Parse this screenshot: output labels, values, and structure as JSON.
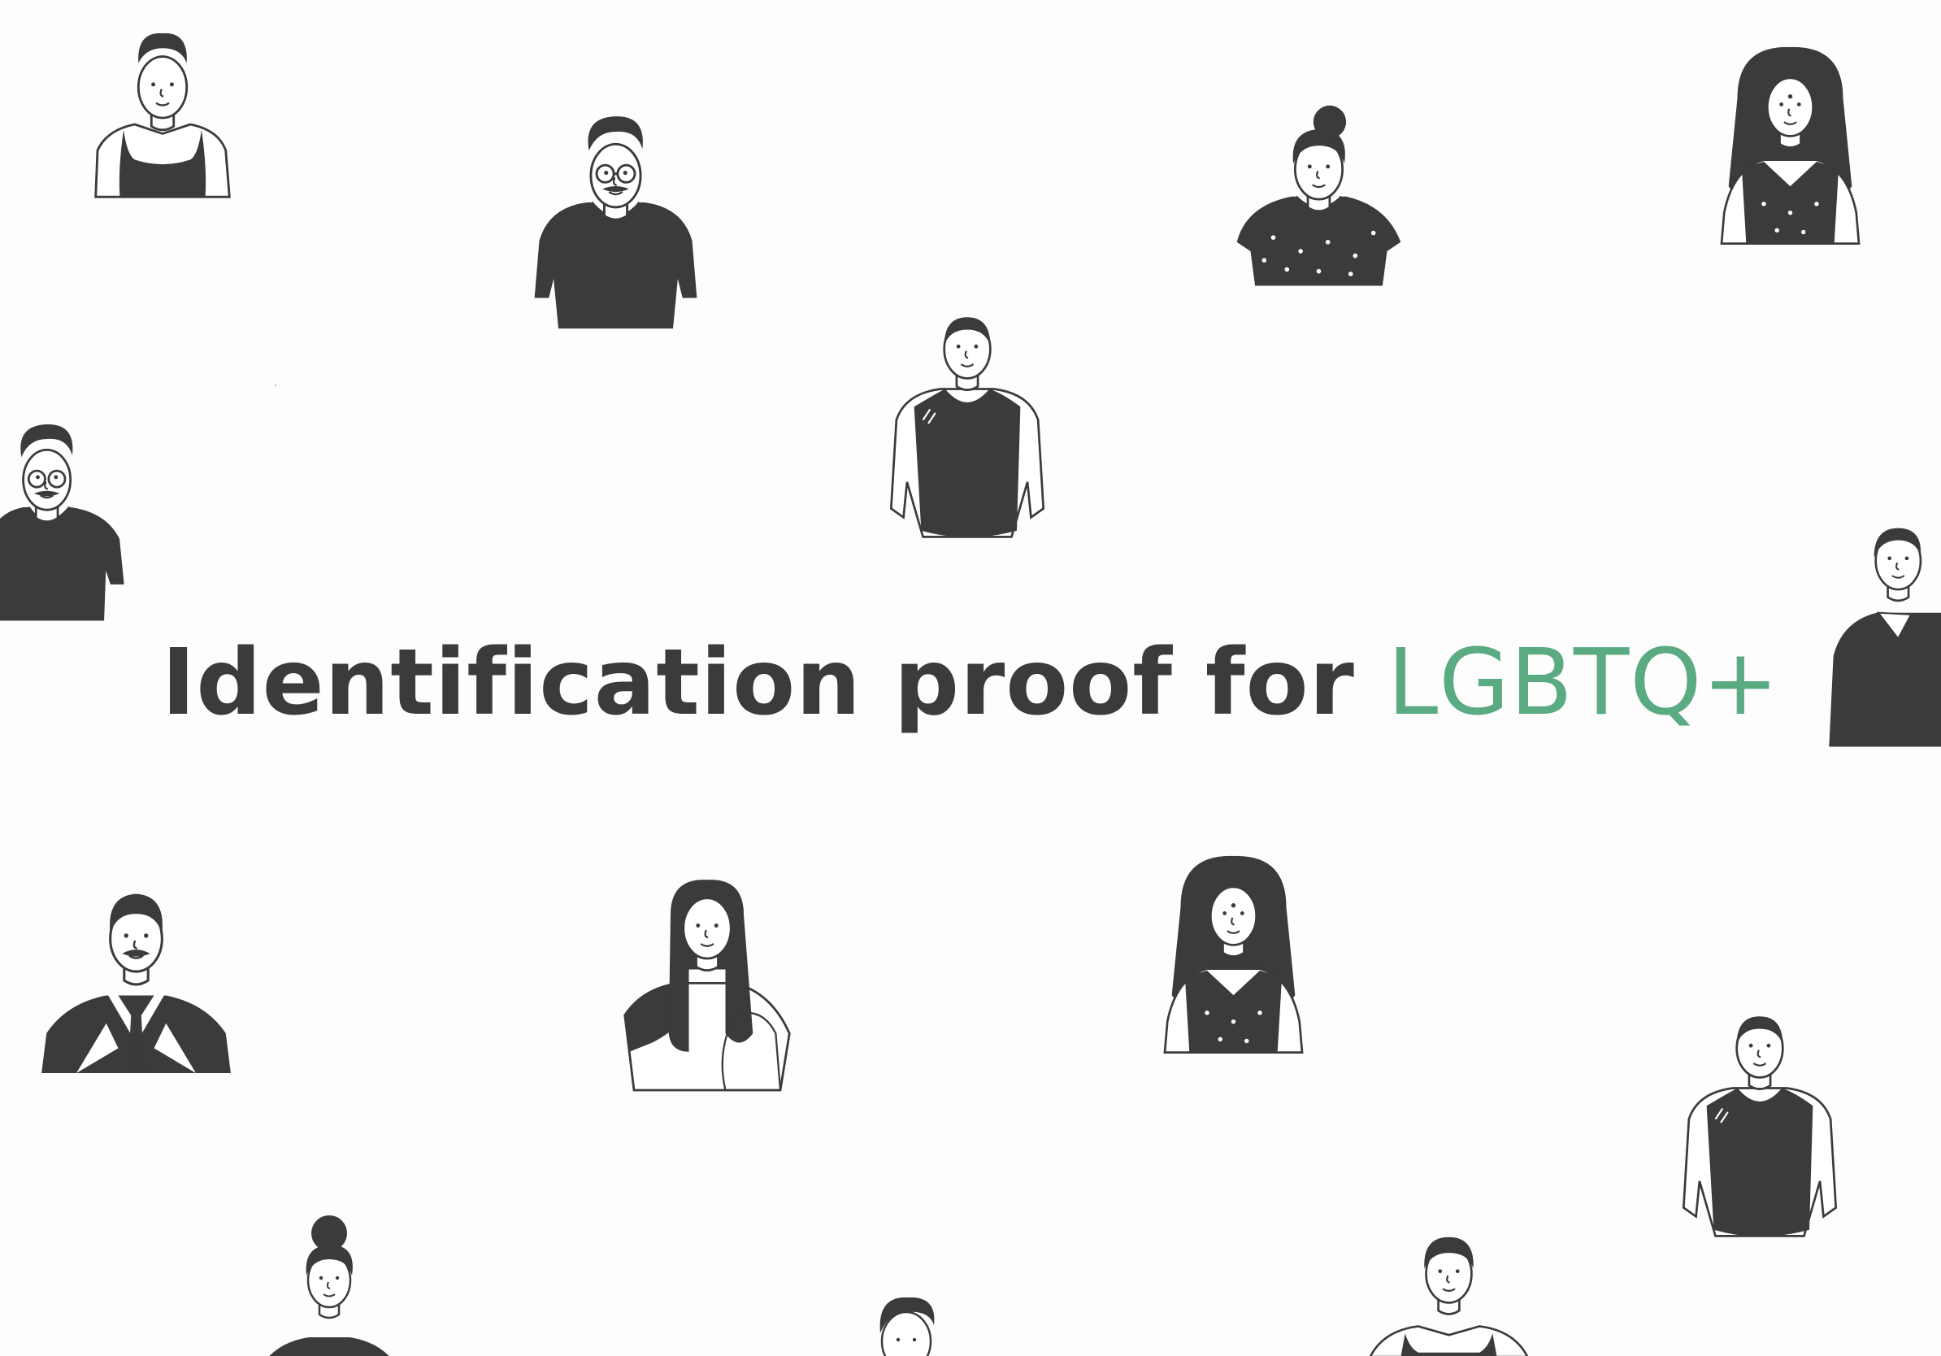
{
  "headline": {
    "prefix": "Identification proof for",
    "accent": "LGBTQ+"
  },
  "colors": {
    "background": "#fdfdfd",
    "ink": "#3a3b3c",
    "accent": "#5aaa82",
    "skin": "#ffffff"
  },
  "illustrations": [
    {
      "name": "person-tank-top-short-hair-icon"
    },
    {
      "name": "person-glasses-mustache-tshirt-icon"
    },
    {
      "name": "person-hair-bun-dotted-blouse-icon"
    },
    {
      "name": "person-long-hair-bindi-dotted-top-icon"
    },
    {
      "name": "person-buzz-cut-tank-top-icon"
    },
    {
      "name": "person-glasses-mustache-tshirt-icon"
    },
    {
      "name": "person-collared-shirt-icon"
    },
    {
      "name": "person-suit-tie-mustache-icon"
    },
    {
      "name": "person-long-hair-saree-icon"
    },
    {
      "name": "person-long-hair-bindi-dotted-top-icon"
    },
    {
      "name": "person-buzz-cut-tank-top-icon"
    },
    {
      "name": "person-hair-bun-top-icon"
    },
    {
      "name": "person-short-hair-icon"
    },
    {
      "name": "person-tank-top-short-hair-icon"
    }
  ]
}
